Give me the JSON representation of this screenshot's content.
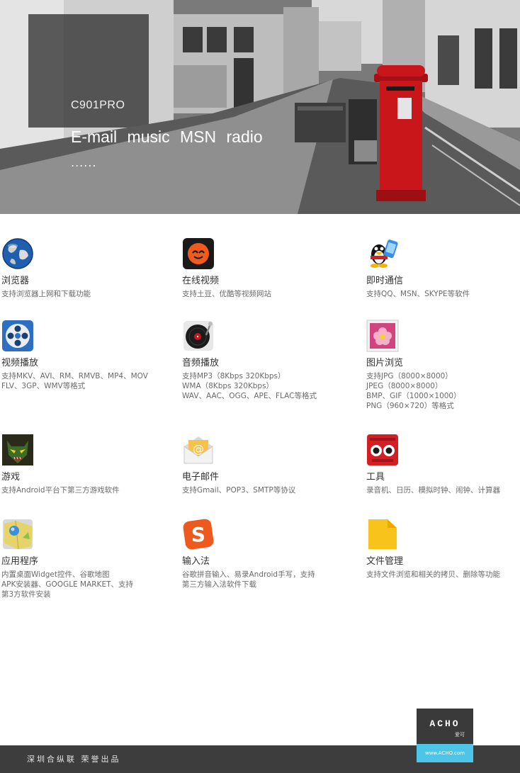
{
  "hero": {
    "model": "C901PRO",
    "tagline": "E-mail  music  MSN  radio",
    "dots": "......"
  },
  "features": [
    {
      "icon": "globe-icon",
      "title": "浏览器",
      "lines": [
        "支持浏览器上网和下载功能"
      ]
    },
    {
      "icon": "online-video-icon",
      "title": "在线视频",
      "lines": [
        "支持土豆、优酷等视频网站"
      ]
    },
    {
      "icon": "instant-messaging-icon",
      "title": "即时通信",
      "lines": [
        "支持QQ、MSN、SKYPE等软件"
      ]
    },
    {
      "icon": "film-reel-icon",
      "title": "视频播放",
      "lines": [
        "支持MKV、AVI、RM、RMVB、MP4、MOV",
        "FLV、3GP、WMV等格式"
      ]
    },
    {
      "icon": "record-player-icon",
      "title": "音频播放",
      "lines": [
        "支持MP3（8Kbps 320Kbps）",
        "WMA（8Kbps 320Kbps）",
        "WAV、AAC、OGG、APE、FLAC等格式"
      ]
    },
    {
      "icon": "picture-icon",
      "title": "图片浏览",
      "lines": [
        "支持JPG（8000×8000）",
        "JPEG（8000×8000）",
        "BMP、GIF（1000×1000）",
        "PNG（960×720）等格式"
      ]
    },
    {
      "icon": "game-monster-icon",
      "title": "游戏",
      "lines": [
        "支持Android平台下第三方游戏软件"
      ]
    },
    {
      "icon": "email-envelope-icon",
      "title": "电子邮件",
      "lines": [
        "支持Gmail、POP3、SMTP等协议"
      ]
    },
    {
      "icon": "tools-icon",
      "title": "工具",
      "lines": [
        "录音机、日历、模拟时钟、闹钟、计算器"
      ]
    },
    {
      "icon": "map-app-icon",
      "title": "应用程序",
      "lines": [
        "内置桌面Widget控件、谷歌地图",
        "APK安装器、GOOGLE MARKET、支持",
        "第3方软件安装"
      ]
    },
    {
      "icon": "sogou-input-icon",
      "title": "输入法",
      "lines": [
        "谷歌拼音输入、易录Android手写，支持",
        "第三方输入法软件下载"
      ]
    },
    {
      "icon": "folder-icon",
      "title": "文件管理",
      "lines": [
        "支持文件浏览和相关的拷贝、删除等功能"
      ]
    }
  ],
  "footer": {
    "text": "深圳合纵联 荣誉出品",
    "brand": "ACHO",
    "brand_cn": "爱可",
    "url": "www.ACHO.com"
  },
  "colors": {
    "postbox_red": "#c8161b",
    "footer_bg": "#3d3d3d",
    "brand_blue": "#4dc4e8"
  }
}
